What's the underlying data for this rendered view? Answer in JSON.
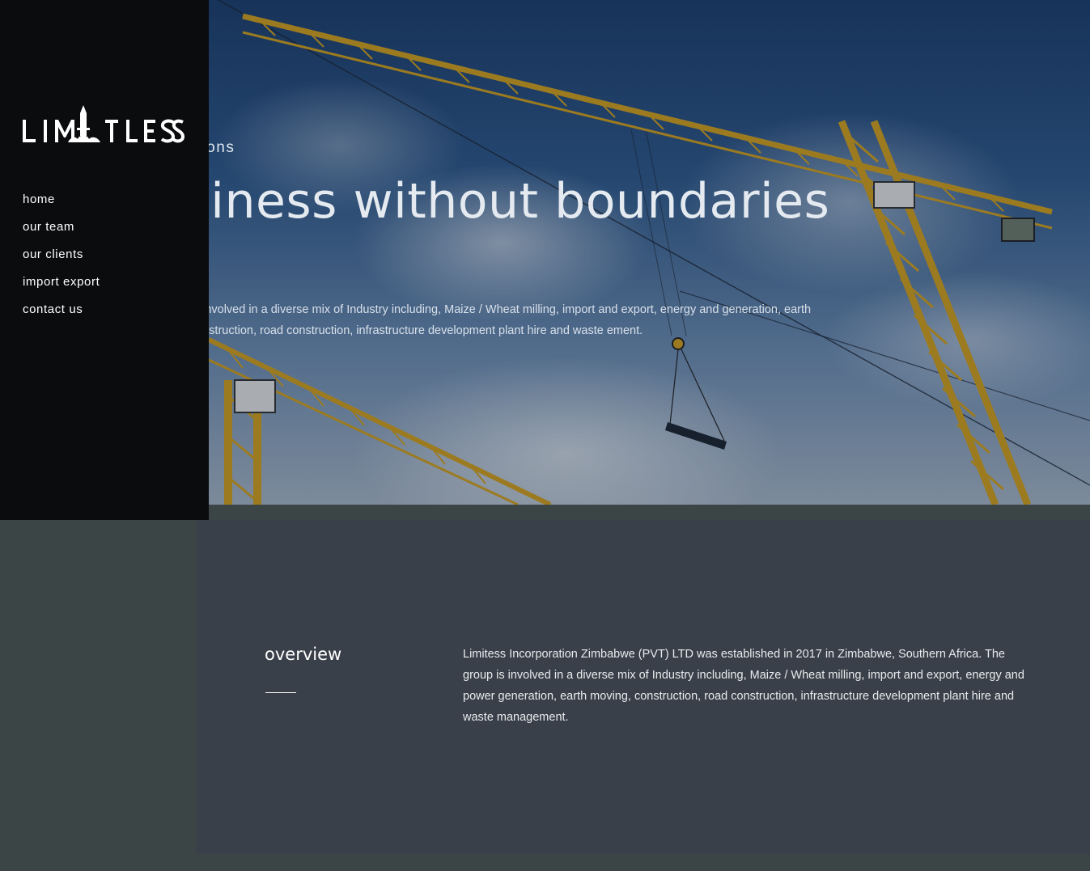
{
  "brand": {
    "name": "LIMITLESS"
  },
  "nav": {
    "items": [
      {
        "label": "home"
      },
      {
        "label": "our team"
      },
      {
        "label": "our clients"
      },
      {
        "label": "import export"
      },
      {
        "label": "contact us"
      }
    ]
  },
  "hero": {
    "eyebrow": "ess visions",
    "headline": "usiness without boundaries",
    "paragraph": "s Group is involved in a diverse mix of Industry including, Maize / Wheat milling, import and export, energy and generation, earth moving, construction, road construction, infrastructure development plant hire and waste ement."
  },
  "overview": {
    "title": "overview",
    "text": "Limitess Incorporation Zimbabwe (PVT) LTD was established in 2017 in Zimbabwe, Southern Africa. The group is involved in a diverse mix of Industry including, Maize / Wheat milling, import and export, energy and power generation, earth moving, construction, road construction, infrastructure development plant hire and waste management."
  },
  "colors": {
    "sidebar": "#0b0c0e",
    "page_background": "#3b4546",
    "overview_panel": "#3a4049",
    "crane": "#d4a21e"
  }
}
